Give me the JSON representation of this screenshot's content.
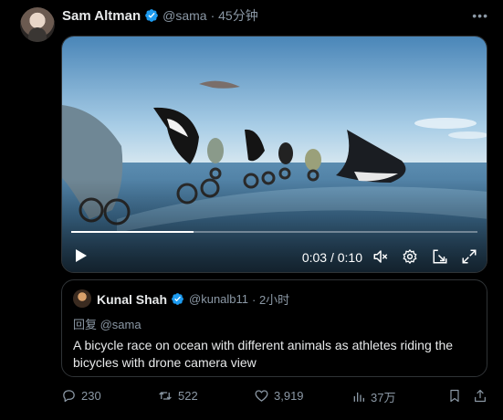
{
  "tweet": {
    "author_name": "Sam Altman",
    "author_handle": "@sama",
    "time": "· 45分钟",
    "more_icon": "more-horizontal-icon"
  },
  "video": {
    "current_time": "0:03",
    "separator": "/",
    "duration": "0:10",
    "progress": 0.3,
    "muted": true
  },
  "quote": {
    "author_name": "Kunal Shah",
    "author_handle": "@kunalb11",
    "time": "· 2小时",
    "reply_to": "回复 @sama",
    "text": "A bicycle race on ocean with different animals as athletes riding the bicycles with drone camera view"
  },
  "actions": {
    "replies": "230",
    "reposts": "522",
    "likes": "3,919",
    "views": "37万"
  },
  "colors": {
    "background": "#000000",
    "text": "#e7e9ea",
    "secondary": "#8b98a5",
    "border": "#2f3336",
    "verified": "#1d9bf0"
  }
}
